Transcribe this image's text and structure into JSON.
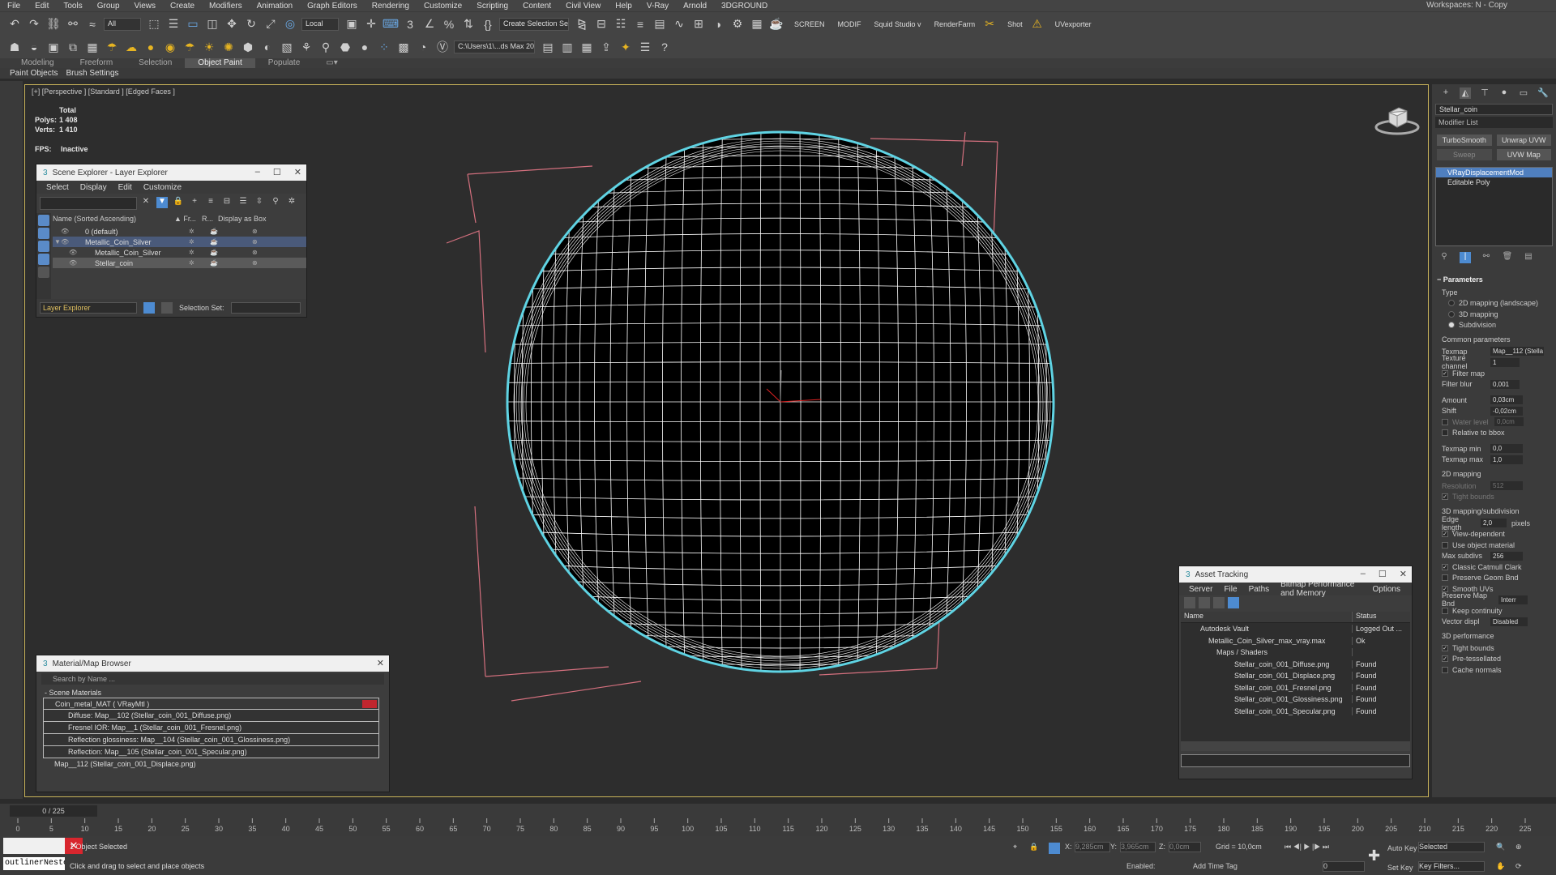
{
  "menu": {
    "items": [
      "File",
      "Edit",
      "Tools",
      "Group",
      "Views",
      "Create",
      "Modifiers",
      "Animation",
      "Graph Editors",
      "Rendering",
      "Customize",
      "Scripting",
      "Content",
      "Civil View",
      "Help",
      "V-Ray",
      "Arnold",
      "3DGROUND"
    ],
    "workspaces": "Workspaces:  N - Copy"
  },
  "toolbar": {
    "filter_all": "All",
    "ref_coord": "Local",
    "selection_set": "Create Selection Se",
    "screen": "SCREEN",
    "modif": "MODIF",
    "squid": "Squid Studio v",
    "renderfarm": "RenderFarm",
    "shot": "Shot",
    "uvexporter": "UVexporter",
    "path": "C:\\Users\\1\\...ds Max 202"
  },
  "ribbon": {
    "tabs": [
      "Modeling",
      "Freeform",
      "Selection",
      "Object Paint",
      "Populate"
    ],
    "active": "Object Paint",
    "sub": [
      "Paint Objects",
      "Brush Settings"
    ]
  },
  "viewport": {
    "label": "[+] [Perspective ] [Standard ] [Edged Faces ]",
    "stats_total": "Total",
    "polys_label": "Polys:",
    "polys_value": "1 408",
    "verts_label": "Verts:",
    "verts_value": "1 410",
    "fps_label": "FPS:",
    "fps_value": "Inactive",
    "wire_color": "#ffffff",
    "outline_color": "#5fd3e3",
    "bbox_color": "#d4707e"
  },
  "scene_explorer": {
    "title": "Scene Explorer - Layer Explorer",
    "menu": [
      "Select",
      "Display",
      "Edit",
      "Customize"
    ],
    "columns": [
      "Name (Sorted Ascending)",
      "▲ Fr...",
      "R...",
      "Display as Box"
    ],
    "rows": [
      {
        "name": "0 (default)"
      },
      {
        "name": "Metallic_Coin_Silver"
      },
      {
        "name": "Metallic_Coin_Silver"
      },
      {
        "name": "Stellar_coin"
      }
    ],
    "footer_label": "Layer Explorer",
    "selection_set": "Selection Set:"
  },
  "material_browser": {
    "title": "Material/Map Browser",
    "search_placeholder": "Search by Name ...",
    "group": "- Scene Materials",
    "items": [
      "Coin_metal_MAT  ( VRayMtl )",
      "Diffuse: Map__102 (Stellar_coin_001_Diffuse.png)",
      "Fresnel IOR: Map__1 (Stellar_coin_001_Fresnel.png)",
      "Reflection glossiness: Map__104 (Stellar_coin_001_Glossiness.png)",
      "Reflection: Map__105 (Stellar_coin_001_Specular.png)",
      "Map__112 (Stellar_coin_001_Displace.png)"
    ]
  },
  "asset_tracking": {
    "title": "Asset Tracking",
    "menu": [
      "Server",
      "File",
      "Paths",
      "Bitmap Performance and Memory",
      "Options"
    ],
    "columns": [
      "Name",
      "Status"
    ],
    "rows": [
      {
        "name": "Autodesk Vault",
        "status": "Logged Out ..."
      },
      {
        "name": "Metallic_Coin_Silver_max_vray.max",
        "status": "Ok"
      },
      {
        "name": "Maps / Shaders",
        "status": ""
      },
      {
        "name": "Stellar_coin_001_Diffuse.png",
        "status": "Found"
      },
      {
        "name": "Stellar_coin_001_Displace.png",
        "status": "Found"
      },
      {
        "name": "Stellar_coin_001_Fresnel.png",
        "status": "Found"
      },
      {
        "name": "Stellar_coin_001_Glossiness.png",
        "status": "Found"
      },
      {
        "name": "Stellar_coin_001_Specular.png",
        "status": "Found"
      }
    ]
  },
  "command_panel": {
    "object_name": "Stellar_coin",
    "modifier_list": "Modifier List",
    "buttons": [
      "TurboSmooth",
      "Unwrap UVW",
      "Sweep",
      "UVW Map"
    ],
    "stack": [
      "VRayDisplacementMod",
      "Editable Poly"
    ],
    "parameters": {
      "header": "Parameters",
      "type_label": "Type",
      "types": [
        "2D mapping (landscape)",
        "3D mapping",
        "Subdivision"
      ],
      "common": "Common parameters",
      "texmap_label": "Texmap",
      "texmap_value": "Map__112 (Stella",
      "texture_channel_label": "Texture channel",
      "texture_channel_value": "1",
      "filter_map": "Filter map",
      "filter_blur_label": "Filter blur",
      "filter_blur_value": "0,001",
      "amount_label": "Amount",
      "amount_value": "0,03cm",
      "shift_label": "Shift",
      "shift_value": "-0,02cm",
      "water_level_label": "Water level",
      "water_level_value": "0,0cm",
      "relative_bbox": "Relative to bbox",
      "texmap_min_label": "Texmap min",
      "texmap_min_value": "0,0",
      "texmap_max_label": "Texmap max",
      "texmap_max_value": "1,0",
      "mapping2d": "2D mapping",
      "resolution_label": "Resolution",
      "resolution_value": "512",
      "tight_bounds_2d": "Tight bounds",
      "mapping3d": "3D mapping/subdivision",
      "edge_length_label": "Edge length",
      "edge_length_value": "2,0",
      "pixels": "pixels",
      "view_dependent": "View-dependent",
      "use_object_material": "Use object material",
      "max_subdivs_label": "Max subdivs",
      "max_subdivs_value": "256",
      "classic_catmull": "Classic Catmull Clark",
      "preserve_geom": "Preserve Geom Bnd",
      "smooth_uvs": "Smooth UVs",
      "preserve_map_label": "Preserve Map Bnd",
      "preserve_map_value": "Interr",
      "keep_continuity": "Keep continuity",
      "vector_displ_label": "Vector displ",
      "vector_displ_value": "Disabled",
      "perf": "3D performance",
      "tight_bounds": "Tight bounds",
      "pre_tessellated": "Pre-tessellated",
      "cache_normals": "Cache normals"
    }
  },
  "timeline": {
    "frame": "0 / 225",
    "ticks": [
      "0",
      "5",
      "10",
      "15",
      "20",
      "25",
      "30",
      "35",
      "40",
      "45",
      "50",
      "55",
      "60",
      "65",
      "70",
      "75",
      "80",
      "85",
      "90",
      "95",
      "100",
      "105",
      "110",
      "115",
      "120",
      "125",
      "130",
      "135",
      "140",
      "145",
      "150",
      "155",
      "160",
      "165",
      "170",
      "175",
      "180",
      "185",
      "190",
      "195",
      "200",
      "205",
      "210",
      "215",
      "220",
      "225"
    ]
  },
  "status": {
    "script_text": "outlinerNeste",
    "selected": "1 Object Selected",
    "hint": "Click and drag to select and place objects",
    "x_label": "X:",
    "x_value": "9,285cm",
    "y_label": "Y:",
    "y_value": "3,965cm",
    "z_label": "Z:",
    "z_value": "0,0cm",
    "grid": "Grid = 10,0cm",
    "enabled": "Enabled:",
    "add_time_tag": "Add Time Tag",
    "auto_key": "Auto Key",
    "auto_key_sel": "Selected",
    "set_key": "Set Key",
    "key_filters": "Key Filters...",
    "frame_field": "0"
  }
}
